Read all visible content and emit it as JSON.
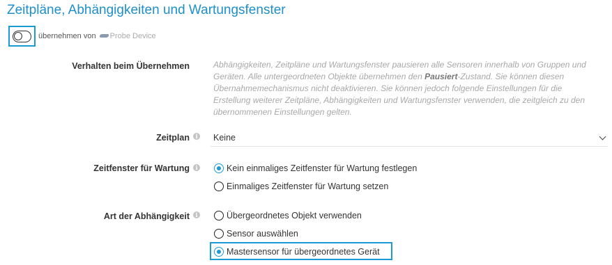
{
  "section": {
    "title": "Zeitpläne, Abhängigkeiten und Wartungsfenster"
  },
  "inherit": {
    "text": "übernehmen von",
    "source": "Probe Device",
    "toggle_state": "off"
  },
  "behavior": {
    "label": "Verhalten beim Übernehmen",
    "description_part1": "Abhängigkeiten, Zeitpläne und Wartungsfenster pausieren alle Sensoren innerhalb von Gruppen und Geräten. Alle untergeordneten Objekte übernehmen den ",
    "description_bold": "Pausiert",
    "description_part2": "-Zustand. Sie können diesen Übernahmemechanismus nicht deaktivieren. Sie können jedoch folgende Einstellungen für die Erstellung weiterer Zeitpläne, Abhängigkeiten und Wartungsfenster verwenden, die zeitgleich zu den übernommenen Einstellungen gelten."
  },
  "schedule": {
    "label": "Zeitplan",
    "value": "Keine"
  },
  "maintenance": {
    "label": "Zeitfenster für Wartung",
    "options": [
      "Kein einmaliges Zeitfenster für Wartung festlegen",
      "Einmaliges Zeitfenster für Wartung setzen"
    ],
    "selected_index": 0
  },
  "dependency": {
    "label": "Art der Abhängigkeit",
    "options": [
      "Übergeordnetes Objekt verwenden",
      "Sensor auswählen",
      "Mastersensor für übergeordnetes Gerät"
    ],
    "selected_index": 2
  },
  "colors": {
    "accent": "#1b9bd6",
    "title": "#1e8fc9",
    "muted_text": "#a8a8a8"
  },
  "icons": {
    "info": "info-icon",
    "probe": "probe-device-icon",
    "dropdown": "chevron-down-icon",
    "toggle": "toggle-switch"
  }
}
